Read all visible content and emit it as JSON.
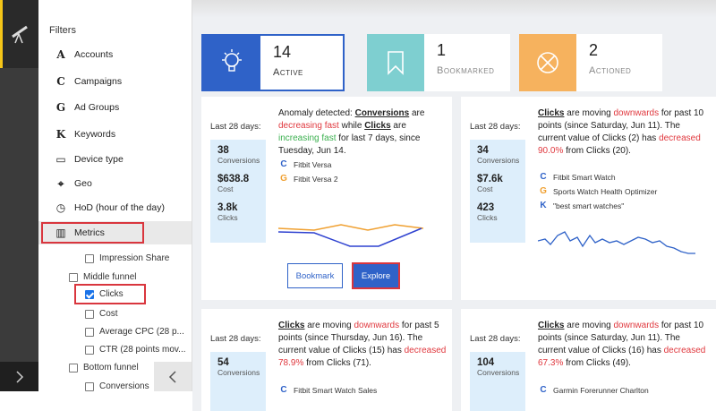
{
  "filters": {
    "title": "Filters",
    "items": [
      {
        "glyph": "A",
        "label": "Accounts"
      },
      {
        "glyph": "C",
        "label": "Campaigns"
      },
      {
        "glyph": "G",
        "label": "Ad Groups"
      },
      {
        "glyph": "K",
        "label": "Keywords"
      },
      {
        "glyph": "▭",
        "label": "Device type"
      },
      {
        "glyph": "⌖",
        "label": "Geo"
      },
      {
        "glyph": "◷",
        "label": "HoD (hour of the day)"
      },
      {
        "glyph": "▥",
        "label": "Metrics"
      }
    ],
    "checks": [
      {
        "label": "Impression Share",
        "checked": false
      },
      {
        "label": "Middle funnel",
        "checked": false
      },
      {
        "label": "Clicks",
        "checked": true
      },
      {
        "label": "Cost",
        "checked": false
      },
      {
        "label": "Average CPC (28 p...",
        "checked": false
      },
      {
        "label": "CTR (28 points mov...",
        "checked": false
      },
      {
        "label": "Bottom funnel",
        "checked": false
      },
      {
        "label": "Conversions",
        "checked": false
      }
    ]
  },
  "stats": [
    {
      "count": "14",
      "label": "Active"
    },
    {
      "count": "1",
      "label": "Bookmarked"
    },
    {
      "count": "2",
      "label": "Actioned"
    }
  ],
  "colors": {
    "accent": "#2f62c8",
    "highlight": "#d9363e",
    "stat_bulb": "#2f62c8",
    "stat_bookmark": "#7ecfd0",
    "stat_actioned": "#f6b25e"
  },
  "cards": [
    {
      "period": "Last 28 days:",
      "metrics": [
        {
          "value": "38",
          "label": "Conversions"
        },
        {
          "value": "$638.8",
          "label": "Cost"
        },
        {
          "value": "3.8k",
          "label": "Clicks"
        }
      ],
      "text": {
        "p1": "Anomaly detected: ",
        "k1": "Conversions",
        "p2": " are ",
        "t1": "decreasing fast",
        "p3": " while ",
        "k2": "Clicks",
        "p4": " are ",
        "t2": "increasing fast",
        "p5": " for last 7 days, since Tuesday, Jun 14."
      },
      "entities": [
        {
          "glyph": "C",
          "name": "Fitbit Versa"
        },
        {
          "glyph": "G",
          "name": "Fitbit Versa 2"
        }
      ],
      "bookmark": "Bookmark",
      "explore": "Explore"
    },
    {
      "period": "Last 28 days:",
      "metrics": [
        {
          "value": "34",
          "label": "Conversions"
        },
        {
          "value": "$7.6k",
          "label": "Cost"
        },
        {
          "value": "423",
          "label": "Clicks"
        }
      ],
      "text": {
        "k1": "Clicks",
        "p1": " are moving ",
        "t1": "downwards",
        "p2": " for past 10 points (since Saturday, Jun 11). The current value of Clicks (2) has ",
        "t2": "decreased 90.0%",
        "p3": " from Clicks (20)."
      },
      "entities": [
        {
          "glyph": "C",
          "name": "Fitbit Smart Watch"
        },
        {
          "glyph": "G",
          "name": "Sports Watch Health Optimizer"
        },
        {
          "glyph": "K",
          "name": "\"best smart watches\""
        }
      ]
    },
    {
      "period": "Last 28 days:",
      "metrics": [
        {
          "value": "54",
          "label": "Conversions"
        }
      ],
      "text": {
        "k1": "Clicks",
        "p1": " are moving ",
        "t1": "downwards",
        "p2": " for past 5 points (since Thursday, Jun 16). The current value of Clicks (15) has ",
        "t2": "decreased 78.9%",
        "p3": " from Clicks (71)."
      },
      "entities": [
        {
          "glyph": "C",
          "name": "Fitbit Smart Watch Sales"
        }
      ]
    },
    {
      "period": "Last 28 days:",
      "metrics": [
        {
          "value": "104",
          "label": "Conversions"
        }
      ],
      "text": {
        "k1": "Clicks",
        "p1": " are moving ",
        "t1": "downwards",
        "p2": " for past 10 points (since Saturday, Jun 11). The current value of Clicks (16) has ",
        "t2": "decreased 67.3%",
        "p3": " from Clicks (49)."
      },
      "entities": [
        {
          "glyph": "C",
          "name": "Garmin Forerunner Charlton"
        }
      ]
    }
  ]
}
